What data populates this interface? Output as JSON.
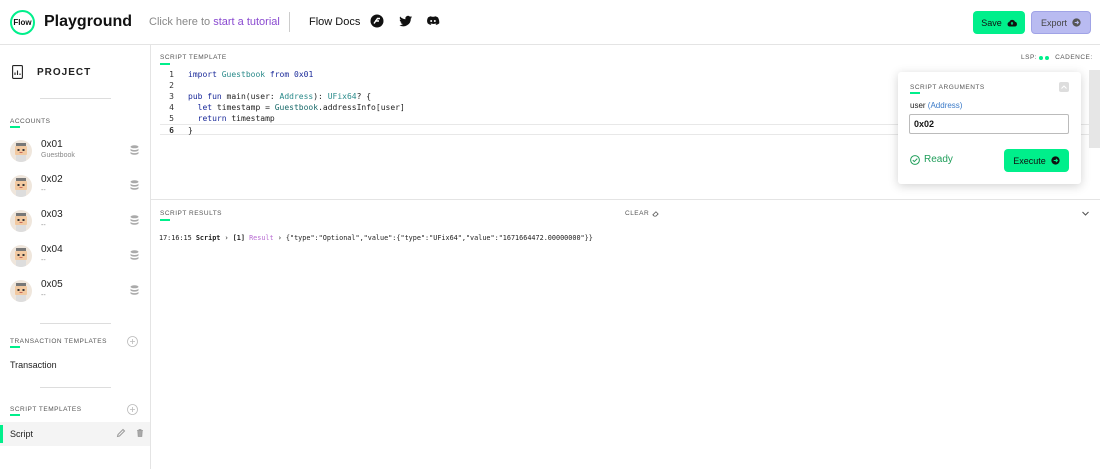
{
  "header": {
    "logo_text": "Flow",
    "title": "Playground",
    "tutorial_prefix": "Click here to ",
    "tutorial_link": "start a tutorial",
    "docs_label": "Flow Docs",
    "save_label": "Save",
    "export_label": "Export",
    "accent_color": "#00ef8b"
  },
  "sidebar": {
    "project_label": "PROJECT",
    "accounts_label": "ACCOUNTS",
    "accounts": [
      {
        "address": "0x01",
        "sub": "Guestbook"
      },
      {
        "address": "0x02",
        "sub": "--"
      },
      {
        "address": "0x03",
        "sub": "--"
      },
      {
        "address": "0x04",
        "sub": "--"
      },
      {
        "address": "0x05",
        "sub": "--"
      }
    ],
    "transaction_templates_label": "TRANSACTION TEMPLATES",
    "transaction_item": "Transaction",
    "script_templates_label": "SCRIPT TEMPLATES",
    "script_item": "Script"
  },
  "editor": {
    "heading": "SCRIPT TEMPLATE",
    "lsp_label": "LSP:",
    "cadence_label": "CADENCE:",
    "line_numbers": [
      "1",
      "2",
      "3",
      "4",
      "5",
      "6"
    ],
    "lines": [
      "import Guestbook from 0x01",
      "",
      "pub fun main(user: Address): UFix64? {",
      "  let timestamp = Guestbook.addressInfo[user]",
      "  return timestamp",
      "}"
    ]
  },
  "args": {
    "title": "SCRIPT ARGUMENTS",
    "param_name": "user",
    "param_type": "(Address)",
    "value": "0x02",
    "status": "Ready",
    "execute_label": "Execute"
  },
  "results": {
    "heading": "SCRIPT RESULTS",
    "clear_label": "CLEAR",
    "time": "17:16:15",
    "kind": "Script",
    "index": "[1]",
    "result_label": "Result",
    "value": "{\"type\":\"Optional\",\"value\":{\"type\":\"UFix64\",\"value\":\"1671664472.00000000\"}}"
  }
}
